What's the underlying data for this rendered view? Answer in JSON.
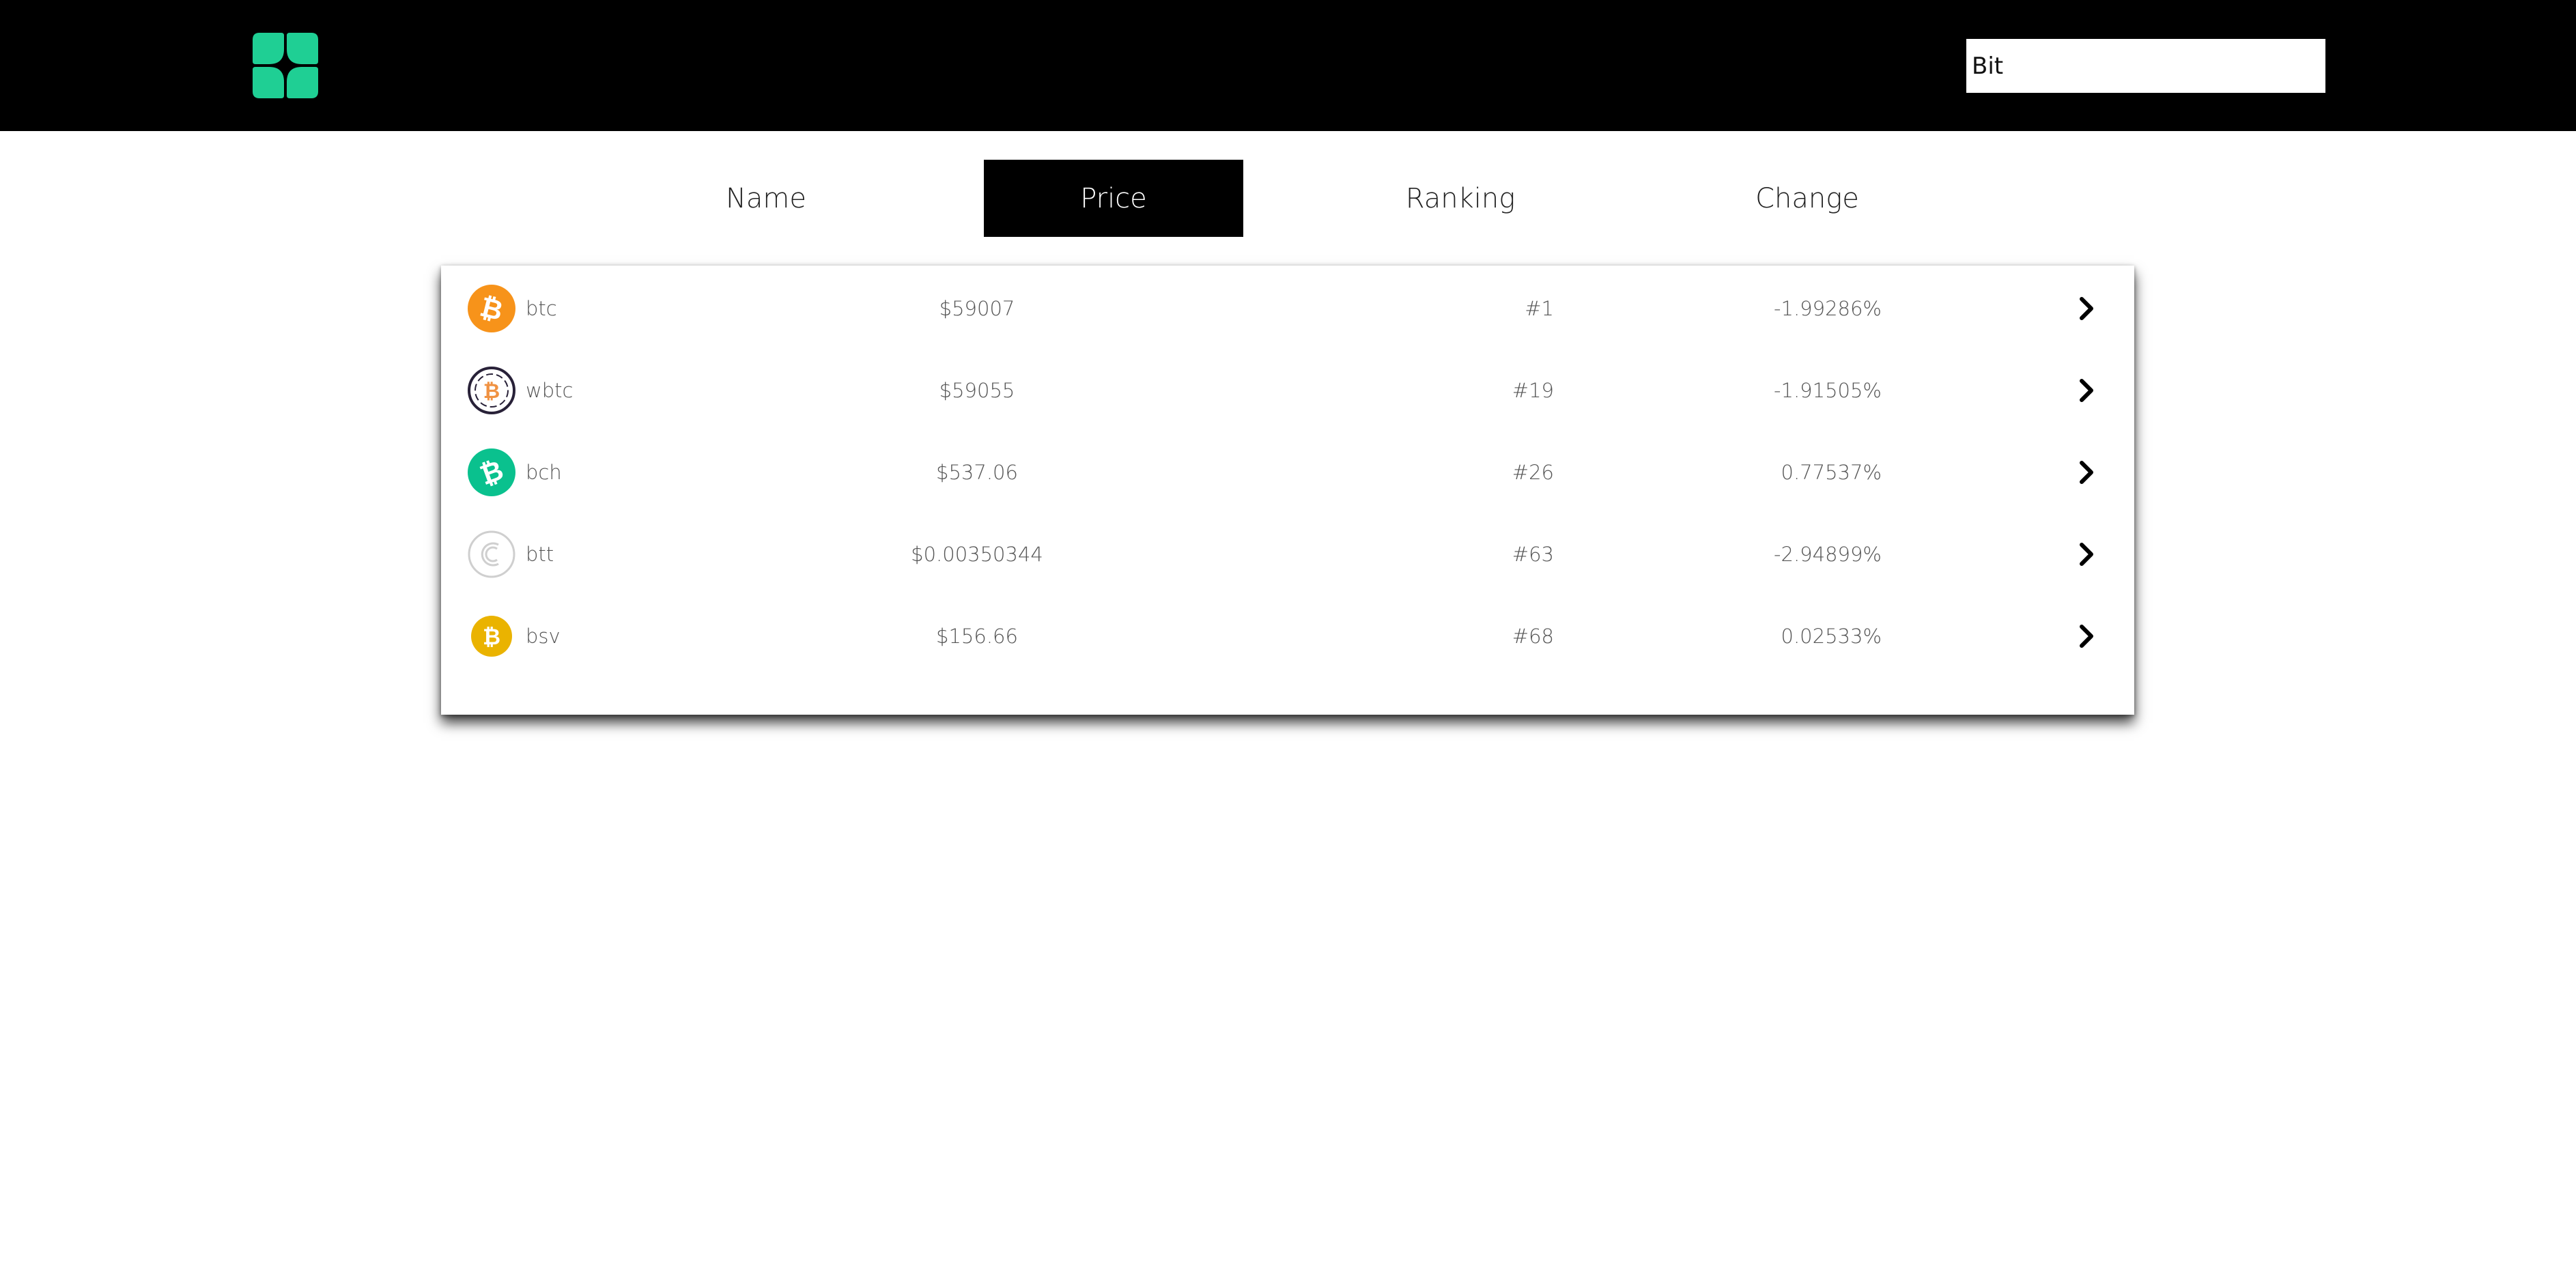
{
  "colors": {
    "header_bg": "#000000",
    "logo": "#1fcf94",
    "active_tab_bg": "#000000",
    "active_tab_text": "#ffffff"
  },
  "search": {
    "value": "Bit"
  },
  "tabs": [
    {
      "label": "Name",
      "active": false
    },
    {
      "label": "Price",
      "active": true
    },
    {
      "label": "Ranking",
      "active": false
    },
    {
      "label": "Change",
      "active": false
    }
  ],
  "coins": [
    {
      "symbol": "btc",
      "price": "$59007",
      "rank": "#1",
      "change": "-1.99286%",
      "icon": "bitcoin-icon",
      "icon_color": "#f7931a"
    },
    {
      "symbol": "wbtc",
      "price": "$59055",
      "rank": "#19",
      "change": "-1.91505%",
      "icon": "wrapped-bitcoin-icon",
      "icon_color": "#f09242"
    },
    {
      "symbol": "bch",
      "price": "$537.06",
      "rank": "#26",
      "change": "0.77537%",
      "icon": "bitcoin-cash-icon",
      "icon_color": "#0ac18e"
    },
    {
      "symbol": "btt",
      "price": "$0.00350344",
      "rank": "#63",
      "change": "-2.94899%",
      "icon": "bittorrent-icon",
      "icon_color": "#cccccc"
    },
    {
      "symbol": "bsv",
      "price": "$156.66",
      "rank": "#68",
      "change": "0.02533%",
      "icon": "bitcoin-sv-icon",
      "icon_color": "#eab300"
    }
  ]
}
